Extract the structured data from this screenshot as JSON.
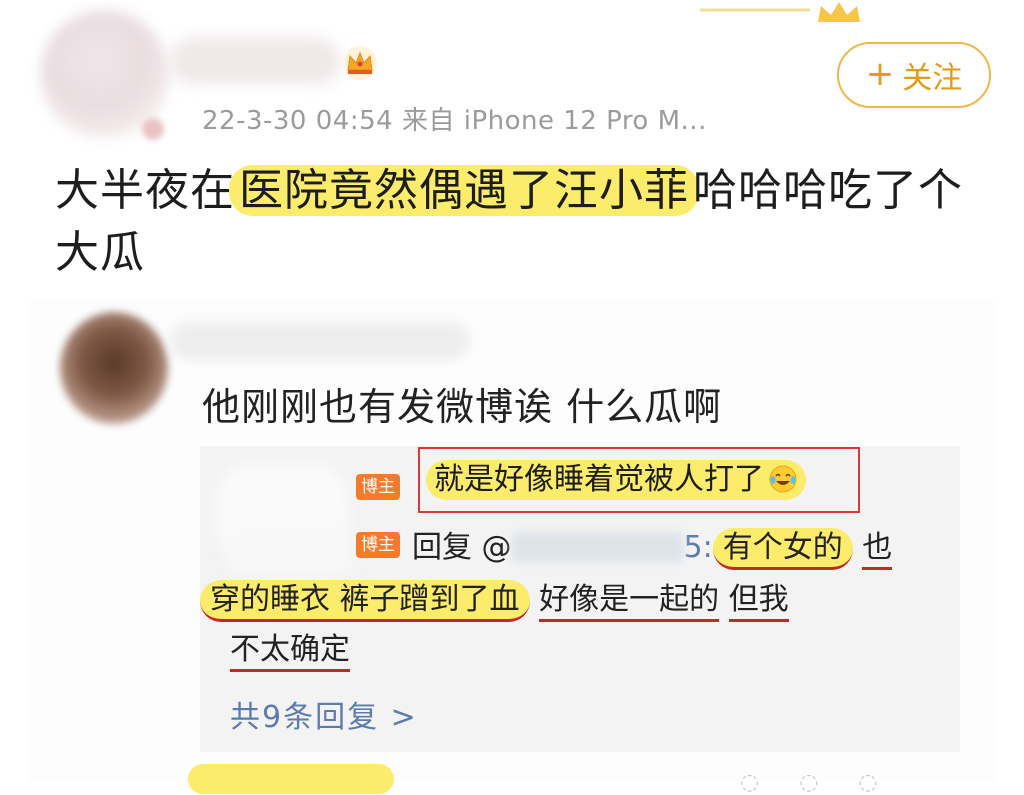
{
  "post": {
    "timestamp": "22-3-30 04:54",
    "source_prefix": "来自",
    "source_device": "iPhone 12 Pro M...",
    "follow_label": "关注",
    "follow_plus": "+",
    "text_pre": "大半夜在",
    "text_highlight": "医院竟然偶遇了汪小菲",
    "text_post": "哈哈哈吃了个大瓜"
  },
  "comment": {
    "text": "他刚刚也有发微博诶 什么瓜啊",
    "author_badge": "博主",
    "reply1_text": "就是好像睡着觉被人打了",
    "reply2_prefix": "回复 @",
    "reply2_mention_tail": "5:",
    "reply2_seg1": "有个女的",
    "reply2_seg2": "也",
    "reply2_seg3": "穿的睡衣 裤子蹭到了血",
    "reply2_seg4": "好像是一起的",
    "reply2_seg5": "但我",
    "reply2_seg6": "不太确定",
    "more_replies": "共9条回复 >"
  },
  "icons": {
    "crown": "crown-icon",
    "laugh": "laugh-cry-emoji-icon"
  },
  "colors": {
    "highlight": "#fbec6c",
    "follow": "#e39a17",
    "link": "#5b7cad",
    "badge": "#f57a2c",
    "annotation": "#d63a3a"
  }
}
